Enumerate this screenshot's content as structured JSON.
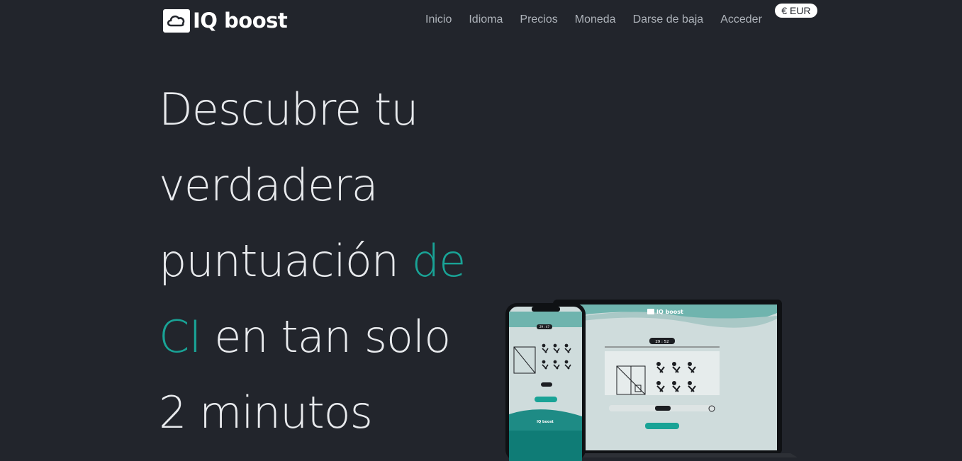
{
  "brand": {
    "name": "IQ boost",
    "logo_icon": "cloud-icon"
  },
  "nav": {
    "items": [
      {
        "label": "Inicio"
      },
      {
        "label": "Idioma"
      },
      {
        "label": "Precios"
      },
      {
        "label": "Moneda"
      },
      {
        "label": "Darse de baja"
      },
      {
        "label": "Acceder"
      }
    ]
  },
  "currency": {
    "label": "€ EUR"
  },
  "hero": {
    "line1": "Descubre tu",
    "line2": "verdadera",
    "line3_a": "puntuación ",
    "line3_b": "de",
    "line4_a": "CI",
    "line4_b": " en tan solo",
    "line5": "2 minutos",
    "accent_color": "#19a396"
  },
  "mockup": {
    "laptop_brand": "IQ boost",
    "laptop_timer": "29 : 52",
    "phone_timer": "29 : 47",
    "phone_brand": "IQ boost"
  }
}
